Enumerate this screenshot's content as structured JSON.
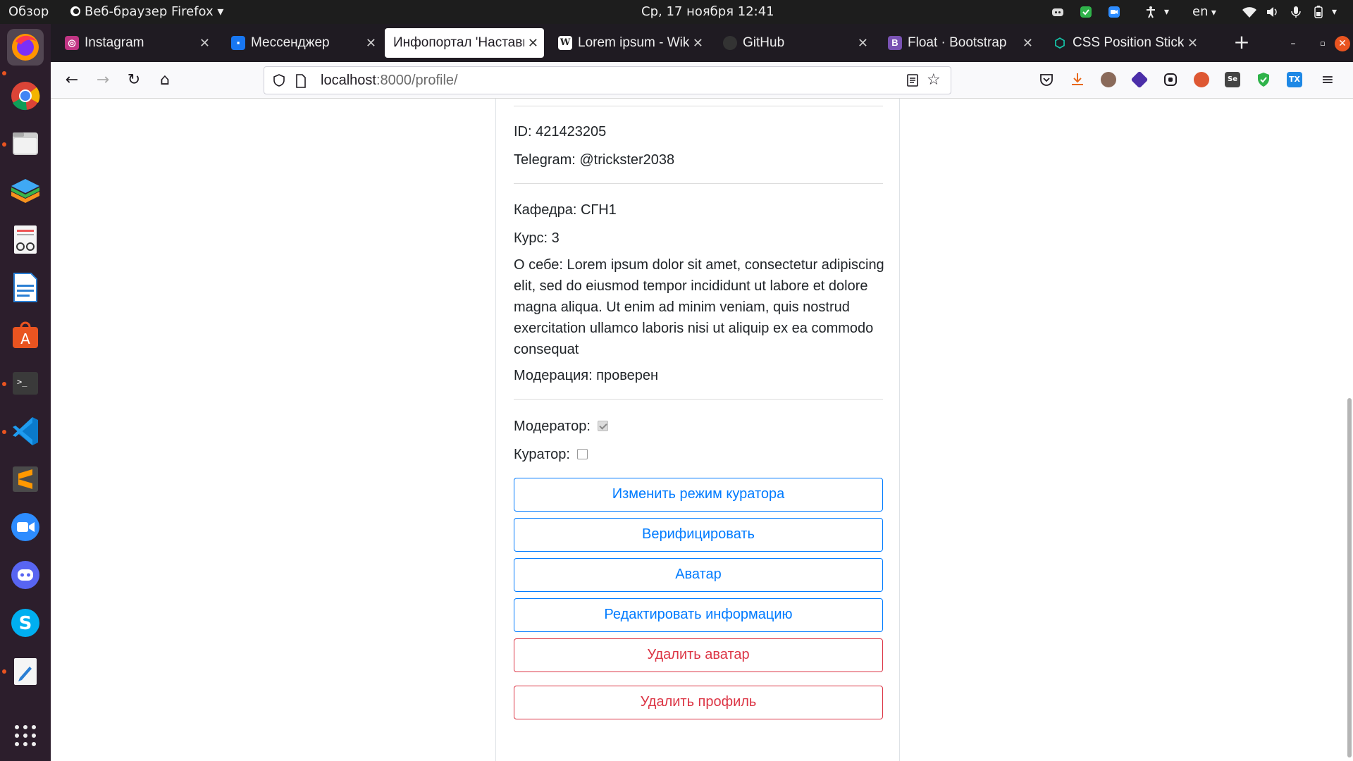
{
  "system": {
    "activities": "Обзор",
    "app_menu": "Веб-браузер Firefox",
    "clock": "Ср, 17 ноября  12:41",
    "lang": "en"
  },
  "dock": {
    "apps": [
      "firefox",
      "chrome",
      "files",
      "layers",
      "document-viewer",
      "libreoffice-writer",
      "app-center",
      "terminal",
      "vscode",
      "sublime-text",
      "zoom",
      "discord",
      "skype",
      "text-editor"
    ],
    "grid_icon": "show-apps-icon"
  },
  "browser": {
    "tabs": [
      {
        "label": "Instagram",
        "icon": "instagram-icon",
        "color": "#c13584"
      },
      {
        "label": "Мессенджер",
        "icon": "messenger-icon",
        "color": "#1877f2"
      },
      {
        "label": "Инфопортал 'Наставн",
        "icon": "",
        "color": "",
        "active": true
      },
      {
        "label": "Lorem ipsum - Wikip",
        "icon": "wikipedia-icon",
        "color": "#ffffff"
      },
      {
        "label": "GitHub",
        "icon": "github-icon",
        "color": "#333333"
      },
      {
        "label": "Float · Bootstrap",
        "icon": "bootstrap-icon",
        "color": "#7952b3"
      },
      {
        "label": "CSS Position Sticky",
        "icon": "codepen-icon",
        "color": "#15c4a8"
      }
    ],
    "url_host": "localhost",
    "url_rest": ":8000/profile/"
  },
  "profile": {
    "id_line": "ID: 421423205",
    "telegram_line": "Telegram: @trickster2038",
    "department_line": "Кафедра: СГН1",
    "course_line": "Курс: 3",
    "about_line": "О себе: Lorem ipsum dolor sit amet, consectetur adipiscing elit, sed do eiusmod tempor incididunt ut labore et dolore magna aliqua. Ut enim ad minim veniam, quis nostrud exercitation ullamco laboris nisi ut aliquip ex ea commodo consequat",
    "moderation_line": "Модерация: проверен",
    "moderator_label": "Модератор:",
    "moderator_checked": true,
    "curator_label": "Куратор:",
    "curator_checked": false
  },
  "actions": {
    "toggle_curator": "Изменить режим куратора",
    "verify": "Верифицировать",
    "avatar": "Аватар",
    "edit_info": "Редактировать информацию",
    "delete_avatar": "Удалить аватар",
    "delete_profile": "Удалить профиль"
  }
}
